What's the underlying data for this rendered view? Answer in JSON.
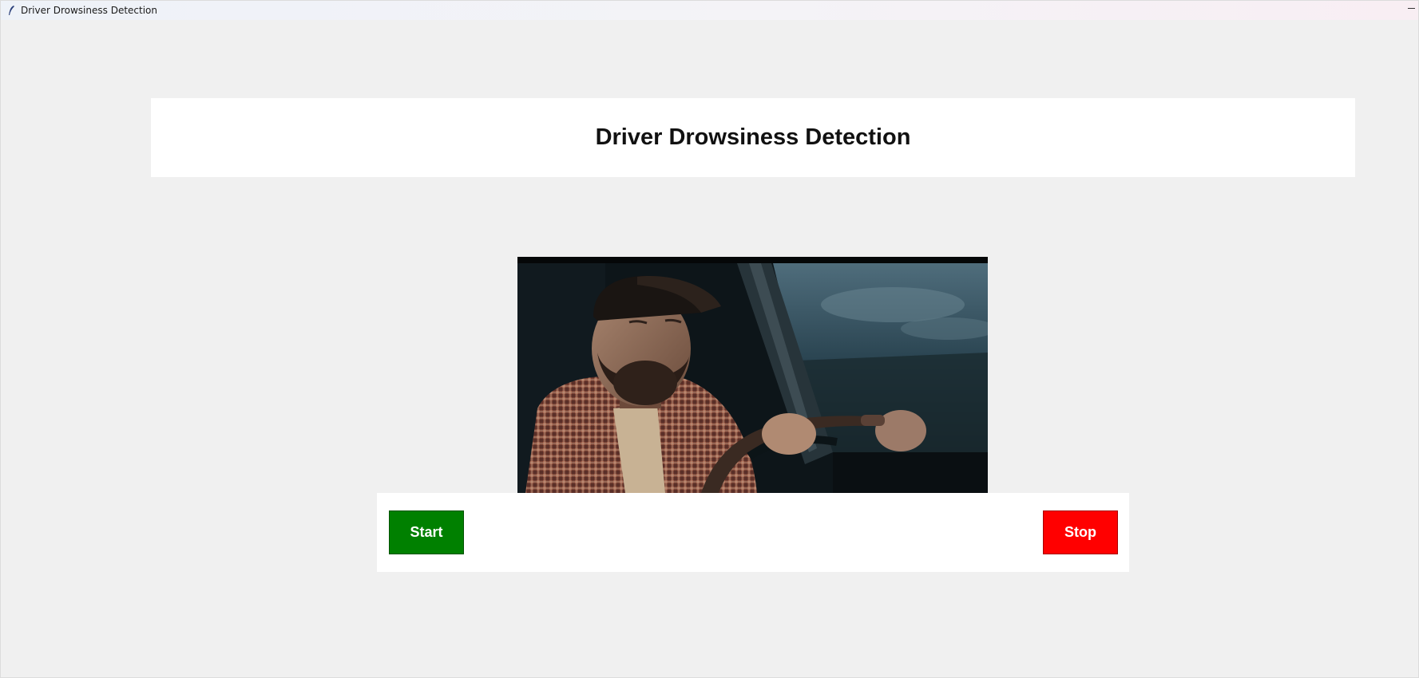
{
  "window": {
    "title": "Driver Drowsiness Detection"
  },
  "header": {
    "title": "Driver Drowsiness Detection"
  },
  "video": {
    "icon": "camera-feed-image"
  },
  "controls": {
    "start_label": "Start",
    "stop_label": "Stop",
    "start_color": "#008000",
    "stop_color": "#ff0000"
  }
}
